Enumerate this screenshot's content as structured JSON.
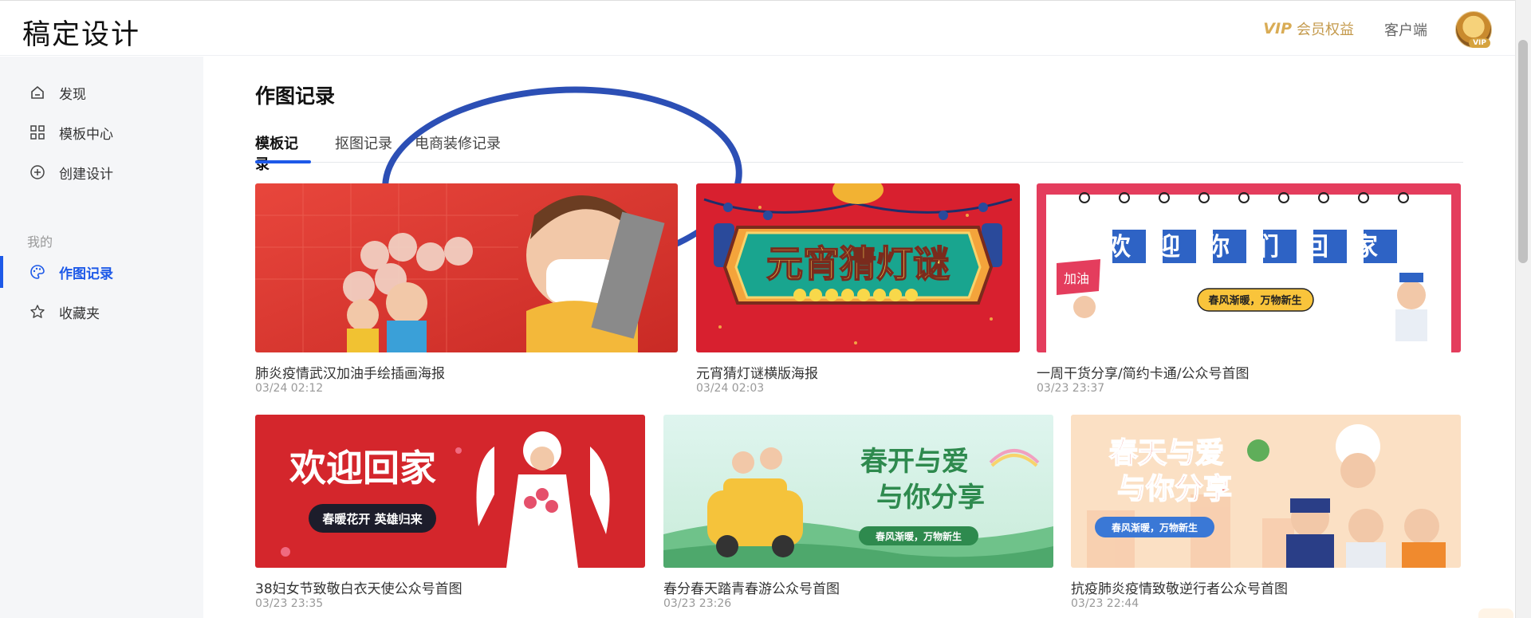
{
  "app": {
    "logo": "稿定设计"
  },
  "header": {
    "vip_badge": "VIP",
    "vip_label": "会员权益",
    "client_label": "客户端",
    "avatar_badge": "VIP"
  },
  "sidebar": {
    "items": [
      {
        "label": "发现",
        "icon": "home-icon"
      },
      {
        "label": "模板中心",
        "icon": "grid-icon"
      },
      {
        "label": "创建设计",
        "icon": "plus-circle-icon"
      }
    ],
    "section_label": "我的",
    "my_items": [
      {
        "label": "作图记录",
        "icon": "palette-icon",
        "active": true
      },
      {
        "label": "收藏夹",
        "icon": "star-icon"
      }
    ]
  },
  "main": {
    "title": "作图记录",
    "tabs": [
      {
        "label": "模板记录",
        "active": true
      },
      {
        "label": "抠图记录"
      },
      {
        "label": "电商装修记录"
      }
    ]
  },
  "records": [
    {
      "title": "肺炎疫情武汉加油手绘插画海报",
      "date": "03/24 02:12",
      "thumb_text": ""
    },
    {
      "title": "元宵猜灯谜横版海报",
      "date": "03/24 02:03",
      "thumb_text": "元宵猜灯谜"
    },
    {
      "title": "一周干货分享/简约卡通/公众号首图",
      "date": "03/23 23:37",
      "thumb_text": "欢迎你们回家",
      "thumb_sub": "春风渐暖，万物新生",
      "thumb_flag": "加油"
    },
    {
      "title": "38妇女节致敬白衣天使公众号首图",
      "date": "03/23 23:35",
      "thumb_text": "欢迎回家",
      "thumb_sub": "春暖花开 英雄归来"
    },
    {
      "title": "春分春天踏青春游公众号首图",
      "date": "03/23 23:26",
      "thumb_text": "春开与爱",
      "thumb_text2": "与你分享",
      "thumb_sub": "春风渐暖，万物新生"
    },
    {
      "title": "抗疫肺炎疫情致敬逆行者公众号首图",
      "date": "03/23 22:44",
      "thumb_text": "春天与爱",
      "thumb_text2": "与你分享",
      "thumb_sub": "春风渐暖，万物新生"
    }
  ],
  "colors": {
    "accent": "#1d59e8",
    "vip": "#c49a4c",
    "highlight": "#2c4fb5"
  }
}
